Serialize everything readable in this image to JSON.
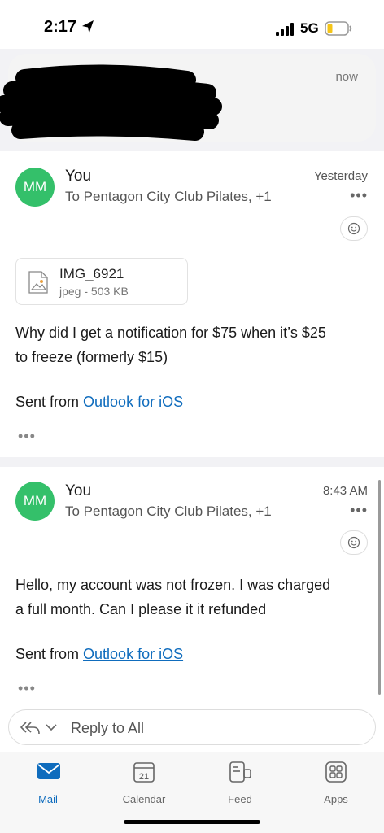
{
  "status_bar": {
    "time": "2:17",
    "network": "5G"
  },
  "notification": {
    "time": "now"
  },
  "messages": [
    {
      "avatar": "MM",
      "sender": "You",
      "recipients": "To Pentagon City Club Pilates, +1",
      "time": "Yesterday",
      "attachment": {
        "name": "IMG_6921",
        "meta": "jpeg - 503 KB"
      },
      "body_line_1": "Why did I get a notification for $75 when it’s $25",
      "body_line_2": "to freeze (formerly $15)",
      "signature_prefix": "Sent from ",
      "signature_link": "Outlook for iOS",
      "more": "•••"
    },
    {
      "avatar": "MM",
      "sender": "You",
      "recipients": "To Pentagon City Club Pilates, +1",
      "time": "8:43 AM",
      "body_line_1": "Hello, my account was not frozen. I was charged",
      "body_line_2": "a full month. Can I please it it refunded",
      "signature_prefix": "Sent from ",
      "signature_link": "Outlook for iOS",
      "more": "•••"
    }
  ],
  "header_more": "•••",
  "reply": {
    "label": "Reply to All"
  },
  "tabs": [
    {
      "label": "Mail",
      "active": true
    },
    {
      "label": "Calendar",
      "day": "21"
    },
    {
      "label": "Feed"
    },
    {
      "label": "Apps"
    }
  ],
  "colors": {
    "accent": "#0f6cbd",
    "avatar": "#34c06a"
  },
  "icons": [
    "location-arrow-icon",
    "signal-icon",
    "battery-icon",
    "image-file-icon",
    "smiley-reaction-icon",
    "reply-all-icon",
    "chevron-down-icon",
    "mail-icon",
    "calendar-icon",
    "feed-icon",
    "apps-icon"
  ]
}
